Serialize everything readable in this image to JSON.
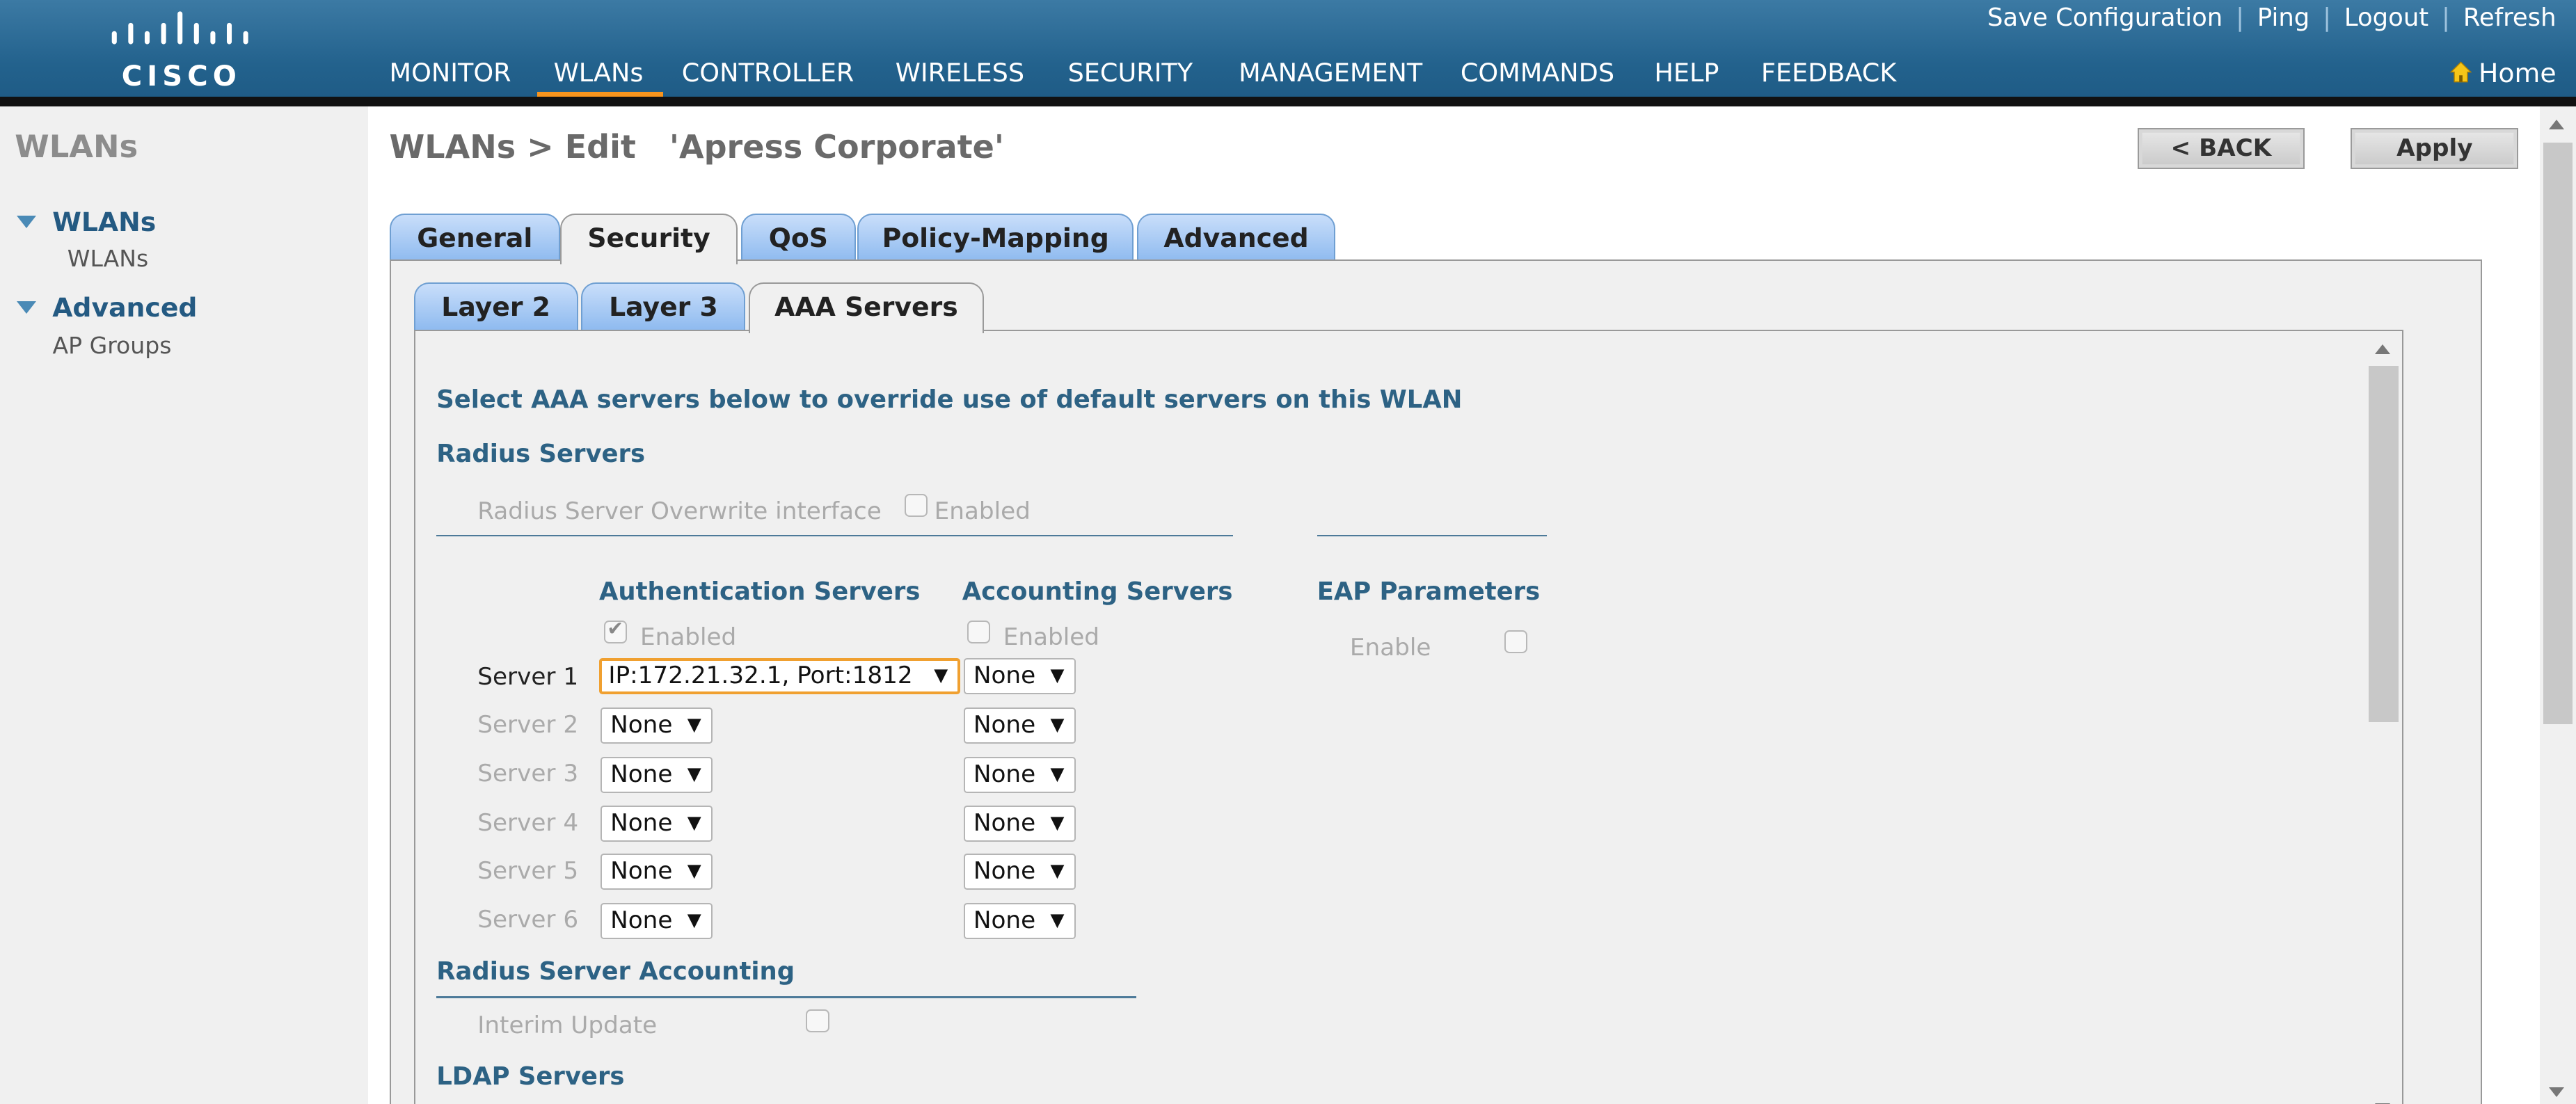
{
  "header": {
    "logo_text": "CISCO",
    "nav": [
      {
        "label": "MONITOR",
        "active": false
      },
      {
        "label": "WLANs",
        "active": true
      },
      {
        "label": "CONTROLLER",
        "active": false
      },
      {
        "label": "WIRELESS",
        "active": false
      },
      {
        "label": "SECURITY",
        "active": false
      },
      {
        "label": "MANAGEMENT",
        "active": false
      },
      {
        "label": "COMMANDS",
        "active": false
      },
      {
        "label": "HELP",
        "active": false
      },
      {
        "label": "FEEDBACK",
        "active": false
      }
    ],
    "links": {
      "save": "Save Configuration",
      "ping": "Ping",
      "logout": "Logout",
      "refresh": "Refresh",
      "sep": "|"
    },
    "home": "Home"
  },
  "sidebar": {
    "title": "WLANs",
    "groups": [
      {
        "label": "WLANs",
        "items": [
          "WLANs"
        ]
      },
      {
        "label": "Advanced",
        "items": [
          "AP Groups"
        ]
      }
    ]
  },
  "page": {
    "title": "WLANs > Edit   'Apress Corporate'",
    "back_label": "< BACK",
    "apply_label": "Apply",
    "tabs": [
      "General",
      "Security",
      "QoS",
      "Policy-Mapping",
      "Advanced"
    ],
    "active_tab": "Security",
    "subtabs": [
      "Layer 2",
      "Layer 3",
      "AAA Servers"
    ],
    "active_subtab": "AAA Servers"
  },
  "aaa": {
    "intro": "Select AAA servers below to override use of default servers on this WLAN",
    "radius_servers": "Radius Servers",
    "overwrite_label": "Radius Server Overwrite interface",
    "overwrite_enabled_label": "Enabled",
    "auth_header": "Authentication Servers",
    "acct_header": "Accounting Servers",
    "eap_header": "EAP Parameters",
    "auth_enabled_label": "Enabled",
    "acct_enabled_label": "Enabled",
    "eap_enable_label": "Enable",
    "servers": [
      {
        "label": "Server 1",
        "auth": "IP:172.21.32.1, Port:1812",
        "acct": "None"
      },
      {
        "label": "Server 2",
        "auth": "None",
        "acct": "None"
      },
      {
        "label": "Server 3",
        "auth": "None",
        "acct": "None"
      },
      {
        "label": "Server 4",
        "auth": "None",
        "acct": "None"
      },
      {
        "label": "Server 5",
        "auth": "None",
        "acct": "None"
      },
      {
        "label": "Server 6",
        "auth": "None",
        "acct": "None"
      }
    ],
    "radius_accounting": "Radius Server Accounting",
    "interim_update": "Interim Update",
    "ldap_servers": "LDAP Servers"
  },
  "colors": {
    "accent": "#f7941d",
    "header": "#23628d",
    "section": "#2d6284"
  }
}
